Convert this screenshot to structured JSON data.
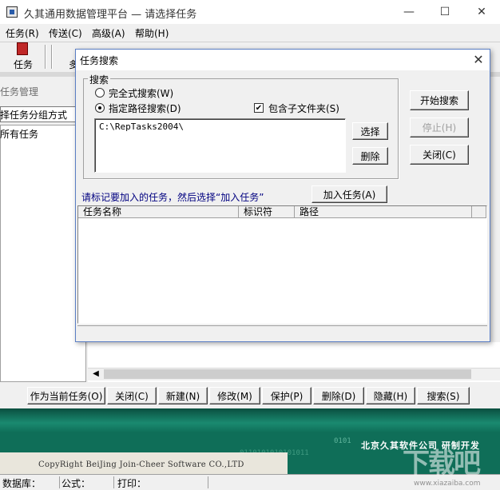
{
  "window": {
    "title": "久其通用数据管理平台 — 请选择任务",
    "minimize_icon": "minimize-icon",
    "maximize_icon": "maximize-icon",
    "close_icon": "close-icon"
  },
  "menu": [
    "任务(R)",
    "传送(C)",
    "高级(A)",
    "帮助(H)"
  ],
  "toolbar": {
    "task_label": "任务",
    "partial_label": "多"
  },
  "left_panel": {
    "title": "任务管理",
    "group_select": "择任务分组方式",
    "tree_root": "所有任务"
  },
  "bottom_buttons": [
    "作为当前任务(O)",
    "关闭(C)",
    "新建(N)",
    "修改(M)",
    "保护(P)",
    "删除(D)",
    "隐藏(H)",
    "搜索(S)"
  ],
  "banner": {
    "copyright": "CopyRight BeiJing Join-Cheer Software CO.,LTD",
    "company": "北京久其软件公司    研制开发",
    "binary_1": "0101",
    "binary_2": "0110101010101011"
  },
  "statusbar": {
    "database": "数据库：",
    "formula": "公式：",
    "print": "打印："
  },
  "dialog": {
    "title": "任务搜索",
    "search_group": "搜索",
    "option_full": "完全式搜索(W)",
    "option_path": "指定路径搜索(D)",
    "include_subfolders": "包含子文件夹(S)",
    "path_value": "C:\\RepTasks2004\\",
    "select_button": "选择",
    "delete_button": "删除",
    "start_button": "开始搜索",
    "stop_button": "停止(H)",
    "close_button": "关闭(C)",
    "hint": "请标记要加入的任务，然后选择“加入任务”",
    "add_button": "加入任务(A)",
    "columns": [
      "任务名称",
      "标识符",
      "路径"
    ]
  },
  "watermark": {
    "text": "下载吧",
    "sub": "www.xiazaiba.com"
  }
}
